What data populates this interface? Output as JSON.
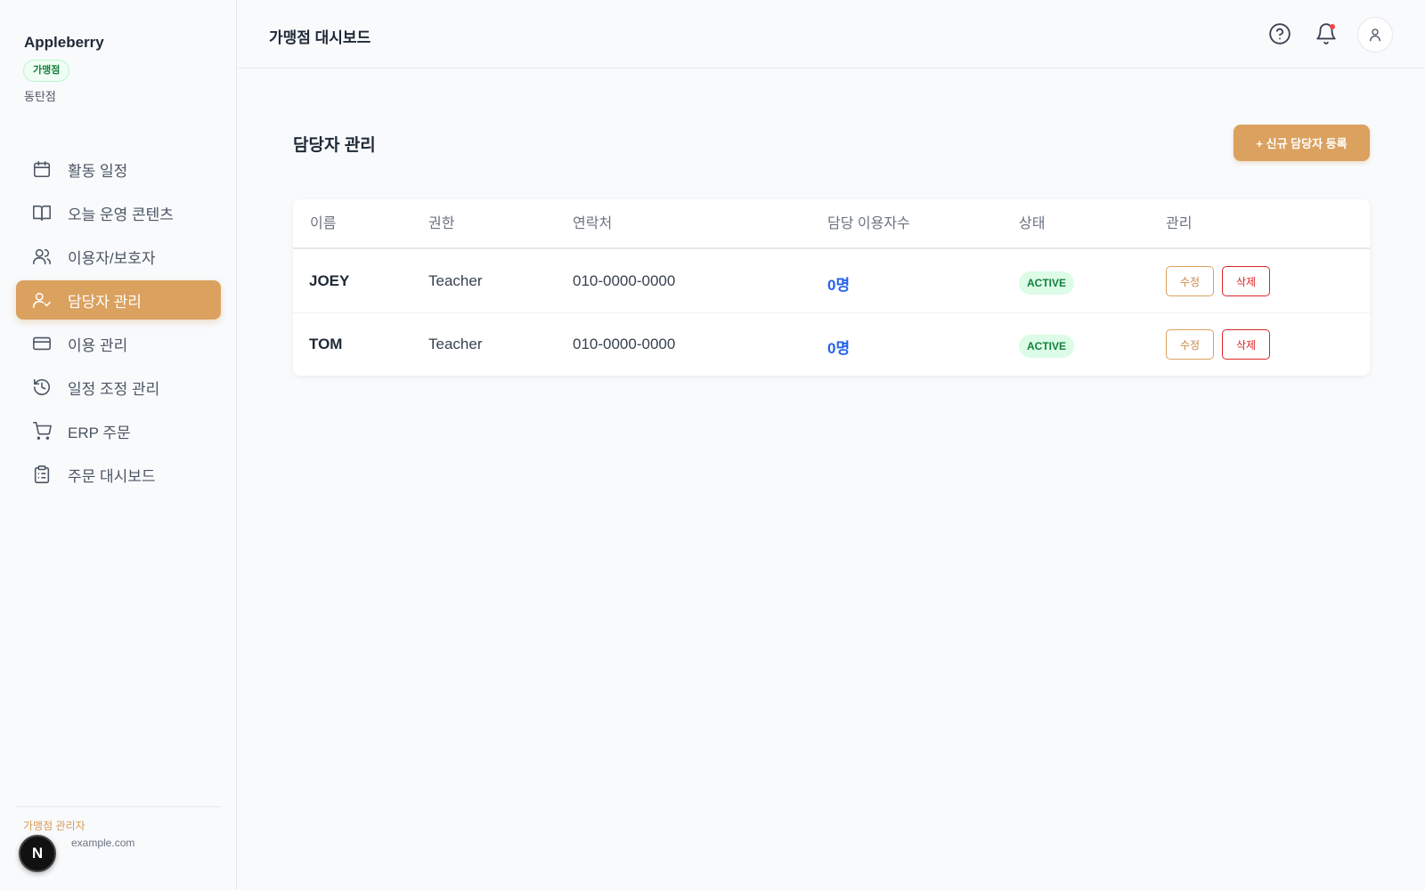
{
  "sidebar": {
    "brand": "Appleberry",
    "role_badge": "가맹점",
    "branch": "동탄점",
    "items": [
      {
        "label": "활동 일정",
        "icon": "calendar-icon"
      },
      {
        "label": "오늘 운영 콘텐츠",
        "icon": "book-icon"
      },
      {
        "label": "이용자/보호자",
        "icon": "users-icon"
      },
      {
        "label": "담당자 관리",
        "icon": "user-check-icon",
        "active": true
      },
      {
        "label": "이용 관리",
        "icon": "credit-card-icon"
      },
      {
        "label": "일정 조정 관리",
        "icon": "history-icon"
      },
      {
        "label": "ERP 주문",
        "icon": "cart-icon"
      },
      {
        "label": "주문 대시보드",
        "icon": "clipboard-icon"
      }
    ],
    "footer": {
      "role": "가맹점 관리자",
      "email": "example.com",
      "badge": "N"
    }
  },
  "header": {
    "title": "가맹점 대시보드"
  },
  "main": {
    "title": "담당자 관리",
    "add_button": "+ 신규 담당자 등록",
    "table": {
      "columns": [
        "이름",
        "권한",
        "연락처",
        "담당 이용자수",
        "상태",
        "관리"
      ],
      "rows": [
        {
          "name": "JOEY",
          "role": "Teacher",
          "phone": "010-0000-0000",
          "count": "0명",
          "status": "ACTIVE",
          "edit": "수정",
          "delete": "삭제"
        },
        {
          "name": "TOM",
          "role": "Teacher",
          "phone": "010-0000-0000",
          "count": "0명",
          "status": "ACTIVE",
          "edit": "수정",
          "delete": "삭제"
        }
      ]
    }
  },
  "colors": {
    "accent": "#dba15f",
    "status_active_bg": "#dcfce7",
    "status_active_text": "#15803d",
    "count_text": "#2563eb",
    "delete": "#dc2626"
  }
}
